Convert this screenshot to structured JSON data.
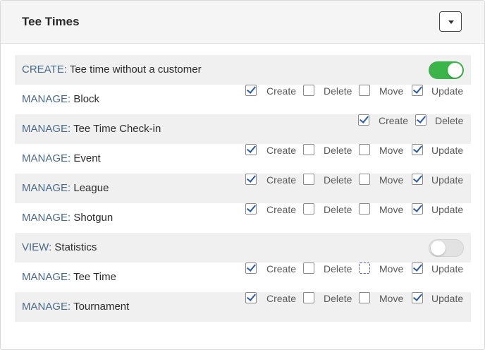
{
  "panel": {
    "title": "Tee Times"
  },
  "colors": {
    "toggle_on": "#3bb54a",
    "toggle_off": "#e2e2e2",
    "check": "#2a5aa8",
    "kind_label": "#4a6a8a"
  },
  "icons": {
    "dropdown": "chevron-down-icon"
  },
  "checkbox_labels": {
    "create": "Create",
    "delete": "Delete",
    "move": "Move",
    "update": "Update"
  },
  "rows": [
    {
      "kind": "CREATE:",
      "name": "Tee time without a customer",
      "control": "toggle",
      "toggle_on": true
    },
    {
      "kind": "MANAGE:",
      "name": "Block",
      "control": "checks",
      "checks": {
        "create": true,
        "delete": false,
        "move": false,
        "update": true
      }
    },
    {
      "kind": "MANAGE:",
      "name": "Tee Time Check-in",
      "control": "checks2",
      "checks": {
        "create": true,
        "delete": true
      }
    },
    {
      "kind": "MANAGE:",
      "name": "Event",
      "control": "checks",
      "checks": {
        "create": true,
        "delete": false,
        "move": false,
        "update": true
      }
    },
    {
      "kind": "MANAGE:",
      "name": "League",
      "control": "checks",
      "checks": {
        "create": true,
        "delete": false,
        "move": false,
        "update": true
      }
    },
    {
      "kind": "MANAGE:",
      "name": "Shotgun",
      "control": "checks",
      "checks": {
        "create": true,
        "delete": false,
        "move": false,
        "update": true
      }
    },
    {
      "kind": "VIEW:",
      "name": "Statistics",
      "control": "toggle",
      "toggle_on": false
    },
    {
      "kind": "MANAGE:",
      "name": "Tee Time",
      "control": "checks",
      "checks": {
        "create": true,
        "delete": false,
        "move": false,
        "update": true
      }
    },
    {
      "kind": "MANAGE:",
      "name": "Tournament",
      "control": "checks",
      "checks": {
        "create": true,
        "delete": false,
        "move": false,
        "update": true
      }
    }
  ]
}
